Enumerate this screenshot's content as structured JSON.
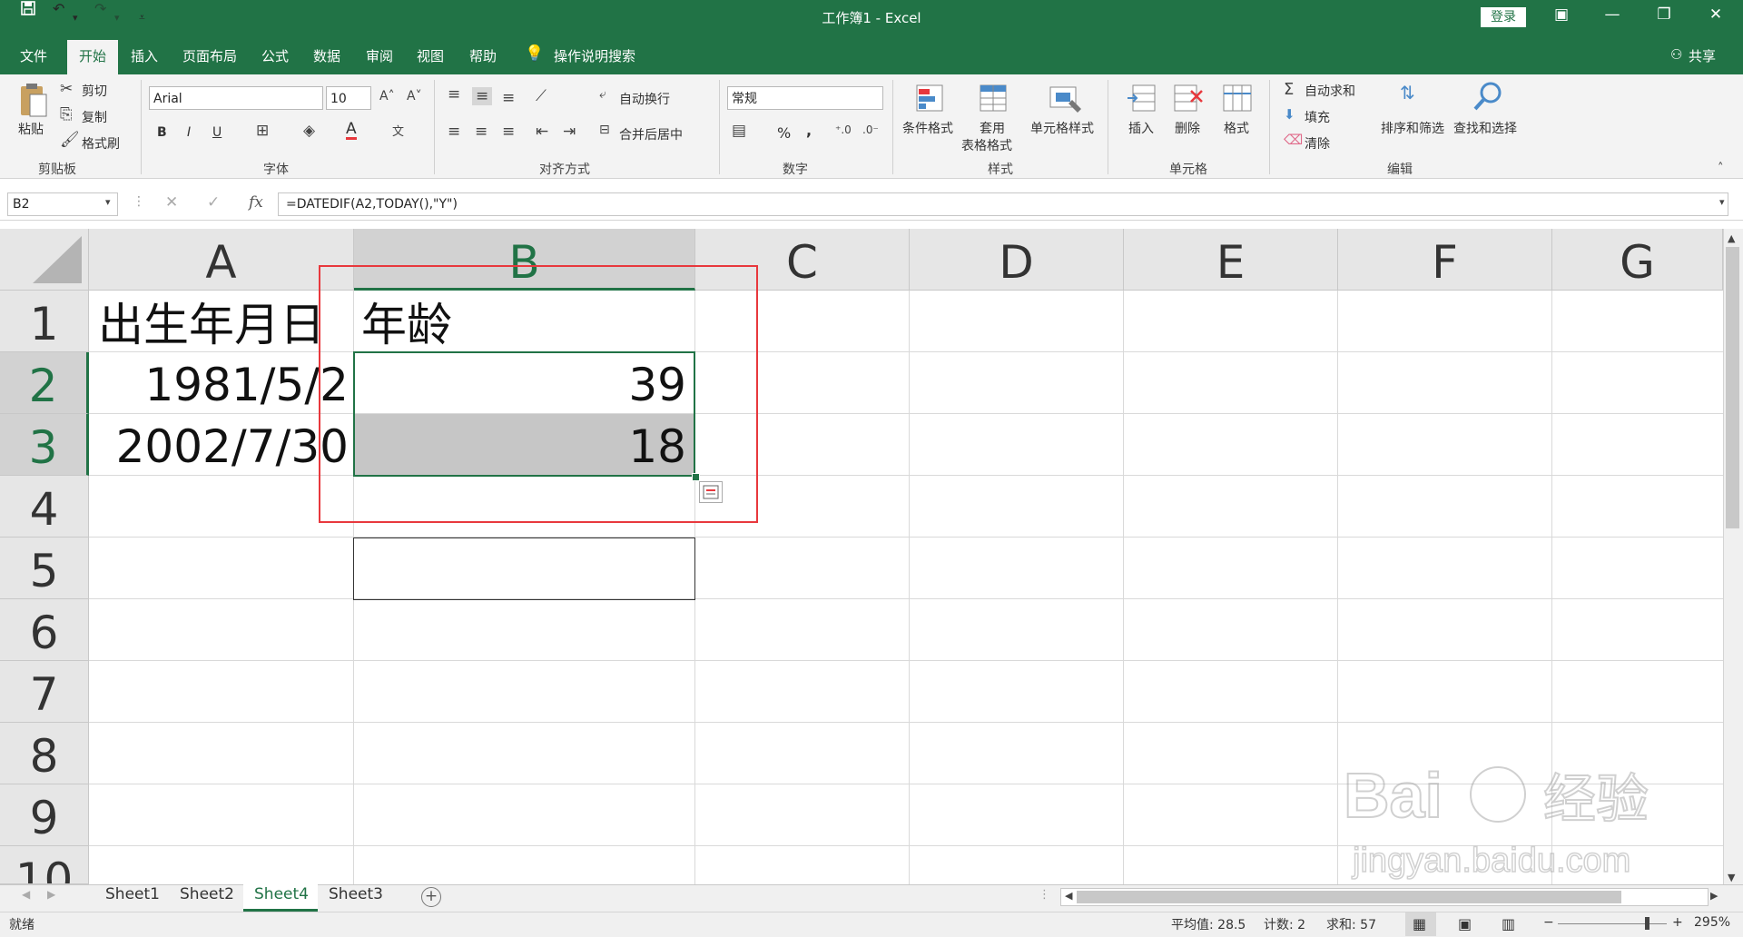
{
  "titlebar": {
    "title": "工作簿1  -  Excel",
    "login": "登录",
    "save_icon": "save-icon",
    "undo_icon": "undo-icon",
    "redo_icon": "redo-icon"
  },
  "tabs": [
    "文件",
    "开始",
    "插入",
    "页面布局",
    "公式",
    "数据",
    "审阅",
    "视图",
    "帮助"
  ],
  "tell_me": "操作说明搜索",
  "share": "共享",
  "ribbon": {
    "clipboard": {
      "paste": "粘贴",
      "cut": "剪切",
      "copy": "复制",
      "format_painter": "格式刷",
      "label": "剪贴板"
    },
    "font": {
      "name": "Arial",
      "size": "10",
      "bold": "B",
      "italic": "I",
      "underline": "U",
      "label": "字体"
    },
    "alignment": {
      "wrap": "自动换行",
      "merge": "合并后居中",
      "label": "对齐方式"
    },
    "number": {
      "format": "常规",
      "percent": "%",
      "comma": ",",
      "label": "数字"
    },
    "styles": {
      "conditional": "条件格式",
      "table1": "套用",
      "table2": "表格格式",
      "cell_styles": "单元格样式",
      "label": "样式"
    },
    "cells": {
      "insert": "插入",
      "delete": "删除",
      "format": "格式",
      "label": "单元格"
    },
    "editing": {
      "autosum": "自动求和",
      "fill": "填充",
      "clear": "清除",
      "sort": "排序和筛选",
      "find": "查找和选择",
      "label": "编辑"
    }
  },
  "formula_bar": {
    "namebox": "B2",
    "fx": "fx",
    "formula": "=DATEDIF(A2,TODAY(),\"Y\")"
  },
  "columns": [
    "A",
    "B",
    "C",
    "D",
    "E",
    "F",
    "G"
  ],
  "rows": [
    "1",
    "2",
    "3",
    "4",
    "5",
    "6",
    "7",
    "8",
    "9",
    "10"
  ],
  "cells": {
    "A1": "出生年月日",
    "B1": "年龄",
    "A2": "1981/5/2",
    "B2": "39",
    "A3": "2002/7/30",
    "B3": "18"
  },
  "sheets": [
    "Sheet1",
    "Sheet2",
    "Sheet4",
    "Sheet3"
  ],
  "active_sheet": "Sheet4",
  "status": {
    "ready": "就绪",
    "average": "平均值: 28.5",
    "count": "计数: 2",
    "sum": "求和: 57",
    "zoom": "295%"
  },
  "colors": {
    "accent": "#217346",
    "annotation": "#e8383d"
  }
}
